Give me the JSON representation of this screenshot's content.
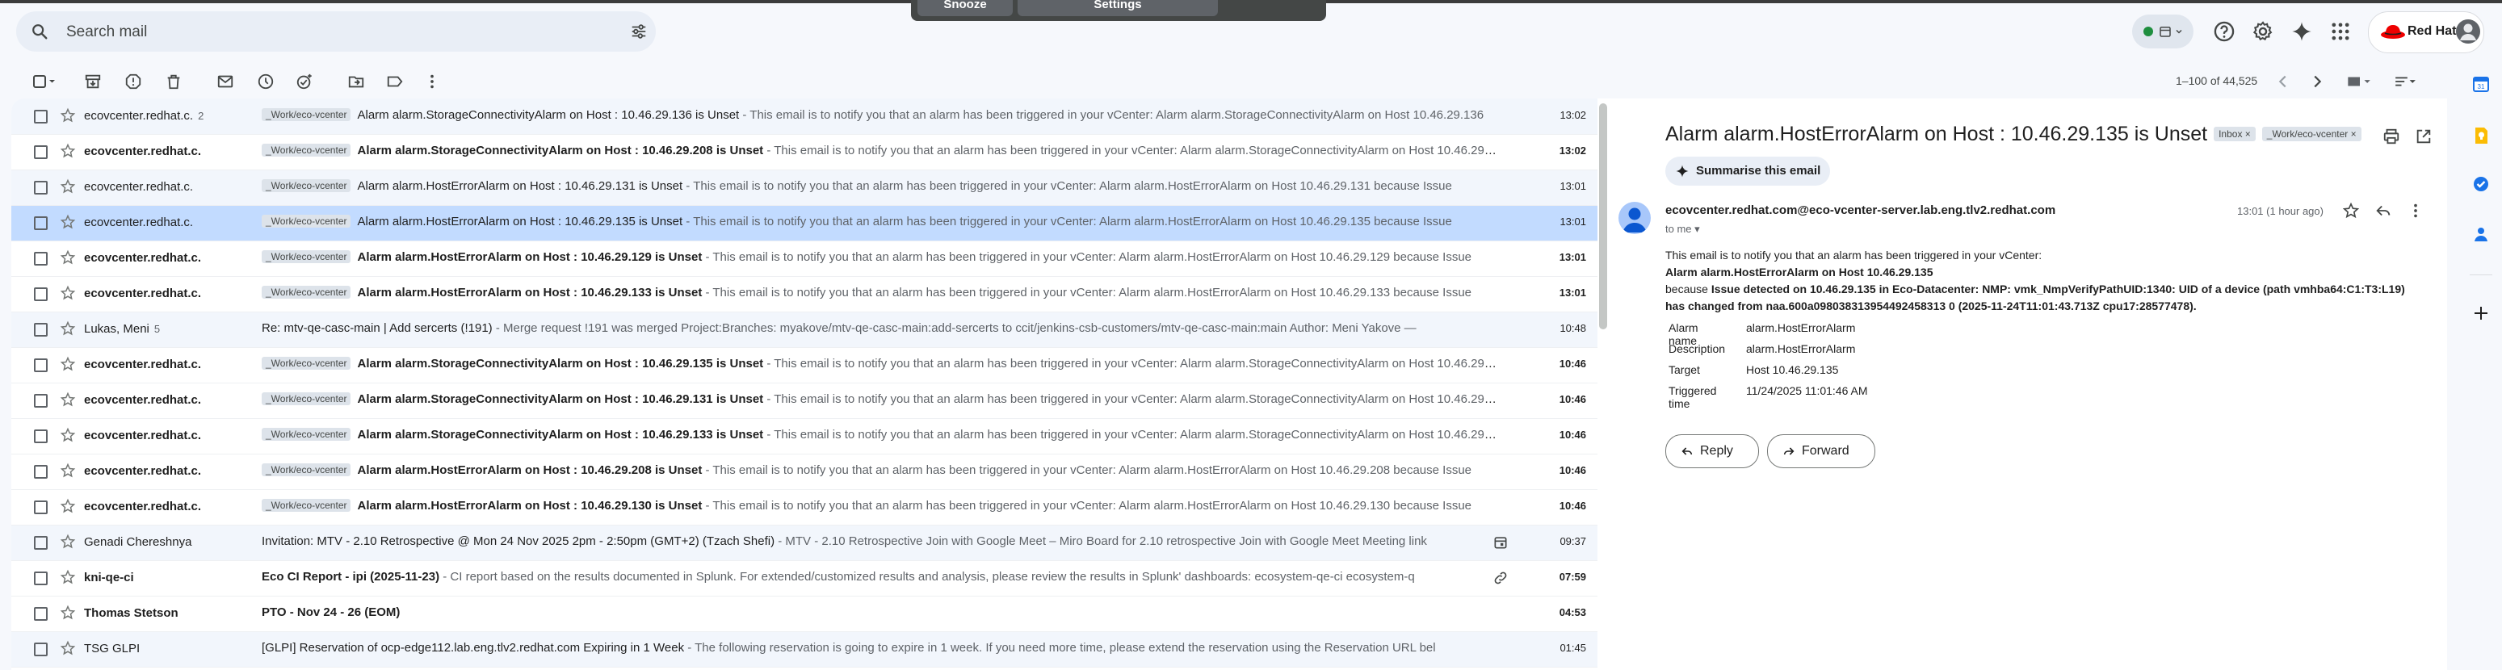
{
  "snooze_bar": {
    "snooze": "Snooze",
    "settings": "Settings"
  },
  "search": {
    "placeholder": "Search mail"
  },
  "account": {
    "brand": "Red Hat"
  },
  "pagination": {
    "range": "1–100 of 44,525"
  },
  "emails": [
    {
      "sender": "ecovcenter.redhat.c.",
      "count": "2",
      "label": "_Work/eco-vcenter",
      "subject": "Alarm alarm.StorageConnectivityAlarm on Host : 10.46.29.136 is Unset",
      "snippet": " - This email is to notify you that an alarm has been triggered in your vCenter: Alarm alarm.StorageConnectivityAlarm on Host 10.46.29.136",
      "time": "13:02",
      "unread": false
    },
    {
      "sender": "ecovcenter.redhat.c.",
      "count": "",
      "label": "_Work/eco-vcenter",
      "subject": "Alarm alarm.StorageConnectivityAlarm on Host : 10.46.29.208 is Unset",
      "snippet": " - This email is to notify you that an alarm has been triggered in your vCenter: Alarm alarm.StorageConnectivityAlarm on Host 10.46.29.208",
      "time": "13:02",
      "unread": true
    },
    {
      "sender": "ecovcenter.redhat.c.",
      "count": "",
      "label": "_Work/eco-vcenter",
      "subject": "Alarm alarm.HostErrorAlarm on Host : 10.46.29.131 is Unset",
      "snippet": " - This email is to notify you that an alarm has been triggered in your vCenter: Alarm alarm.HostErrorAlarm on Host 10.46.29.131 because Issue",
      "time": "13:01",
      "unread": false
    },
    {
      "sender": "ecovcenter.redhat.c.",
      "count": "",
      "label": "_Work/eco-vcenter",
      "subject": "Alarm alarm.HostErrorAlarm on Host : 10.46.29.135 is Unset",
      "snippet": " - This email is to notify you that an alarm has been triggered in your vCenter: Alarm alarm.HostErrorAlarm on Host 10.46.29.135 because Issue",
      "time": "13:01",
      "unread": false,
      "selected": true
    },
    {
      "sender": "ecovcenter.redhat.c.",
      "count": "",
      "label": "_Work/eco-vcenter",
      "subject": "Alarm alarm.HostErrorAlarm on Host : 10.46.29.129 is Unset",
      "snippet": " - This email is to notify you that an alarm has been triggered in your vCenter: Alarm alarm.HostErrorAlarm on Host 10.46.29.129 because Issue",
      "time": "13:01",
      "unread": true
    },
    {
      "sender": "ecovcenter.redhat.c.",
      "count": "",
      "label": "_Work/eco-vcenter",
      "subject": "Alarm alarm.HostErrorAlarm on Host : 10.46.29.133 is Unset",
      "snippet": " - This email is to notify you that an alarm has been triggered in your vCenter: Alarm alarm.HostErrorAlarm on Host 10.46.29.133 because Issue",
      "time": "13:01",
      "unread": true
    },
    {
      "sender": "Lukas, Meni",
      "count": "5",
      "label": "",
      "subject": "Re: mtv-qe-casc-main | Add sercerts (!191)",
      "snippet": " - Merge request !191 was merged Project:Branches: myakove/mtv-qe-casc-main:add-sercerts to ccit/jenkins-csb-customers/mtv-qe-casc-main:main Author: Meni Yakove —",
      "time": "10:48",
      "unread": false
    },
    {
      "sender": "ecovcenter.redhat.c.",
      "count": "",
      "label": "_Work/eco-vcenter",
      "subject": "Alarm alarm.StorageConnectivityAlarm on Host : 10.46.29.135 is Unset",
      "snippet": " - This email is to notify you that an alarm has been triggered in your vCenter: Alarm alarm.StorageConnectivityAlarm on Host 10.46.29.135",
      "time": "10:46",
      "unread": true
    },
    {
      "sender": "ecovcenter.redhat.c.",
      "count": "",
      "label": "_Work/eco-vcenter",
      "subject": "Alarm alarm.StorageConnectivityAlarm on Host : 10.46.29.131 is Unset",
      "snippet": " - This email is to notify you that an alarm has been triggered in your vCenter: Alarm alarm.StorageConnectivityAlarm on Host 10.46.29.131",
      "time": "10:46",
      "unread": true
    },
    {
      "sender": "ecovcenter.redhat.c.",
      "count": "",
      "label": "_Work/eco-vcenter",
      "subject": "Alarm alarm.StorageConnectivityAlarm on Host : 10.46.29.133 is Unset",
      "snippet": " - This email is to notify you that an alarm has been triggered in your vCenter: Alarm alarm.StorageConnectivityAlarm on Host 10.46.29.133",
      "time": "10:46",
      "unread": true
    },
    {
      "sender": "ecovcenter.redhat.c.",
      "count": "",
      "label": "_Work/eco-vcenter",
      "subject": "Alarm alarm.HostErrorAlarm on Host : 10.46.29.208 is Unset",
      "snippet": " - This email is to notify you that an alarm has been triggered in your vCenter: Alarm alarm.HostErrorAlarm on Host 10.46.29.208 because Issue",
      "time": "10:46",
      "unread": true
    },
    {
      "sender": "ecovcenter.redhat.c.",
      "count": "",
      "label": "_Work/eco-vcenter",
      "subject": "Alarm alarm.HostErrorAlarm on Host : 10.46.29.130 is Unset",
      "snippet": " - This email is to notify you that an alarm has been triggered in your vCenter: Alarm alarm.HostErrorAlarm on Host 10.46.29.130 because Issue",
      "time": "10:46",
      "unread": true
    },
    {
      "sender": "Genadi Chereshnya",
      "count": "",
      "label": "",
      "subject": "Invitation: MTV - 2.10 Retrospective @ Mon 24 Nov 2025 2pm - 2:50pm (GMT+2) (Tzach Shefi)",
      "snippet": " - MTV - 2.10 Retrospective Join with Google Meet – Miro Board for 2.10 retrospective Join with Google Meet Meeting link",
      "time": "09:37",
      "unread": false,
      "attach": "calendar"
    },
    {
      "sender": "kni-qe-ci",
      "count": "",
      "label": "",
      "subject": "Eco CI Report - ipi (2025-11-23)",
      "snippet": " - CI report based on the results documented in Splunk. For extended/customized results and analysis, please review the results in Splunk' dashboards: ecosystem-qe-ci ecosystem-q",
      "time": "07:59",
      "unread": true,
      "attach": "link"
    },
    {
      "sender": "Thomas Stetson",
      "count": "",
      "label": "",
      "subject": "PTO - Nov 24 - 26 (EOM)",
      "snippet": "",
      "time": "04:53",
      "unread": true
    },
    {
      "sender": "TSG GLPI",
      "count": "",
      "label": "",
      "subject": "[GLPI] Reservation of ocp-edge112.lab.eng.tlv2.redhat.com Expiring in 1 Week",
      "snippet": " - The following reservation is going to expire in 1 week. If you need more time, please extend the reservation using the Reservation URL bel",
      "time": "01:45",
      "unread": false
    }
  ],
  "message": {
    "title": "Alarm alarm.HostErrorAlarm on Host : 10.46.29.135 is Unset",
    "labels": [
      "Inbox",
      "_Work/eco-vcenter"
    ],
    "summarise": "Summarise this email",
    "from": "ecovcenter.redhat.com@eco-vcenter-server.lab.eng.tlv2.redhat.com",
    "to": "to me",
    "time": "13:01 (1 hour ago)",
    "line1": "This email is to notify you that an alarm has been triggered in your vCenter:",
    "line2": "Alarm alarm.HostErrorAlarm on Host 10.46.29.135",
    "line3_prefix": "because ",
    "line3_bold": "Issue detected on 10.46.29.135 in Eco-Datacenter: NMP: vmk_NmpVerifyPathUID:1340: UID of a device (path vmhba64:C1:T3:L19) has changed from naa.600a098038313954492458313 0 (2025-11-24T11:01:43.713Z cpu17:28577478).",
    "details": [
      {
        "key": "Alarm name",
        "value": "alarm.HostErrorAlarm"
      },
      {
        "key": "Description",
        "value": "alarm.HostErrorAlarm"
      },
      {
        "key": "Target",
        "value": "Host 10.46.29.135"
      },
      {
        "key": "Triggered time",
        "value": "11/24/2025 11:01:46 AM"
      }
    ],
    "reply": "Reply",
    "forward": "Forward"
  },
  "colors": {
    "accent": "#0b57d0",
    "selected_row": "#c2dbff",
    "brand_red": "#ee0000",
    "status_green": "#1e8e3e"
  }
}
